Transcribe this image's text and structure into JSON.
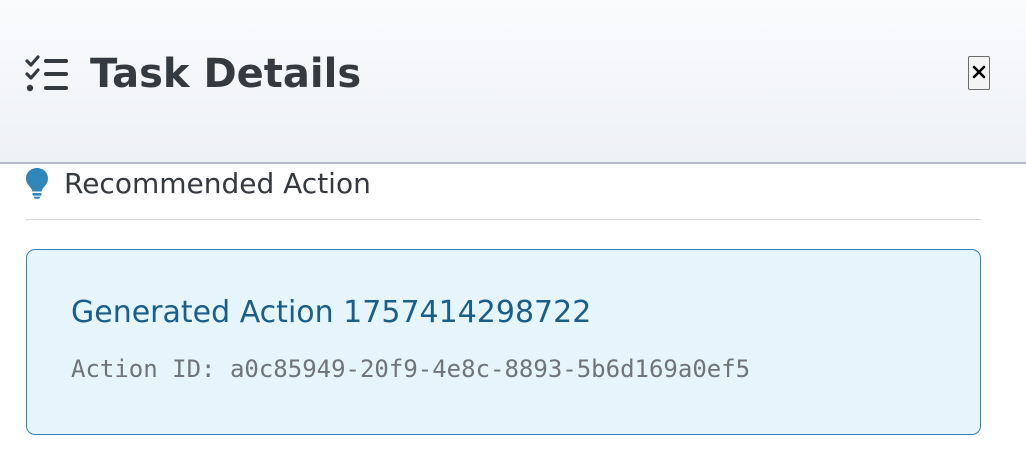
{
  "header": {
    "title": "Task Details",
    "icon": "task-list-icon",
    "close_icon": "close-icon",
    "close_label": "Close"
  },
  "recommended": {
    "heading": "Recommended Action",
    "icon": "lightbulb-icon",
    "icon_color": "#2f86b8"
  },
  "action": {
    "title": "Generated Action 1757414298722",
    "id_text": "Action ID: a0c85949-20f9-4e8c-8893-5b6d169a0ef5"
  },
  "colors": {
    "card_background": "#e6f4fb",
    "card_border": "#2f86b8",
    "action_title": "#1a5f8c",
    "title_text": "#343a40"
  }
}
